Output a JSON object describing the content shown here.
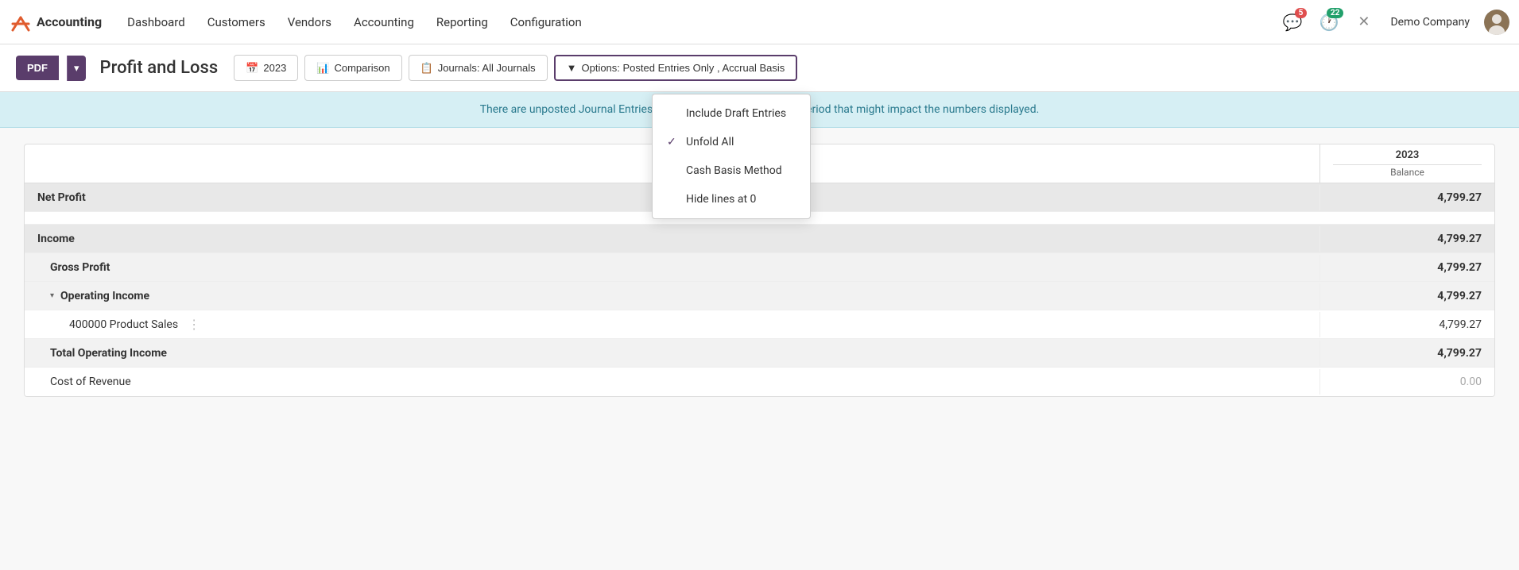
{
  "app": {
    "logo_text": "Accounting",
    "logo_icon": "✖"
  },
  "nav": {
    "items": [
      {
        "label": "Dashboard",
        "id": "dashboard"
      },
      {
        "label": "Customers",
        "id": "customers"
      },
      {
        "label": "Vendors",
        "id": "vendors"
      },
      {
        "label": "Accounting",
        "id": "accounting"
      },
      {
        "label": "Reporting",
        "id": "reporting"
      },
      {
        "label": "Configuration",
        "id": "configuration"
      }
    ],
    "badges": {
      "messages_count": "5",
      "activities_count": "22"
    },
    "company": "Demo Company"
  },
  "toolbar": {
    "pdf_label": "PDF",
    "page_title": "Profit and Loss",
    "year_btn": "2023",
    "comparison_btn": "Comparison",
    "journals_btn": "Journals: All Journals",
    "options_btn": "Options: Posted Entries Only , Accrual Basis"
  },
  "banner": {
    "text": "There are unposted Journal Entries prior to the end of this report period that might impact the numbers displayed."
  },
  "dropdown": {
    "items": [
      {
        "label": "Include Draft Entries",
        "checked": false,
        "id": "include-draft"
      },
      {
        "label": "Unfold All",
        "checked": true,
        "id": "unfold-all"
      },
      {
        "label": "Cash Basis Method",
        "checked": false,
        "id": "cash-basis"
      },
      {
        "label": "Hide lines at 0",
        "checked": false,
        "id": "hide-zero"
      }
    ]
  },
  "report": {
    "year_col": "2023",
    "balance_col": "Balance",
    "rows": [
      {
        "label": "Net Profit",
        "value": "4,799.27",
        "type": "section-header",
        "indent": 0
      },
      {
        "label": "",
        "value": "",
        "type": "spacer",
        "indent": 0
      },
      {
        "label": "Income",
        "value": "4,799.27",
        "type": "section-header",
        "indent": 0
      },
      {
        "label": "Gross Profit",
        "value": "4,799.27",
        "type": "sub-section",
        "indent": 1
      },
      {
        "label": "Operating Income",
        "value": "4,799.27",
        "type": "sub-section",
        "indent": 1,
        "expandable": true
      },
      {
        "label": "400000 Product Sales",
        "value": "4,799.27",
        "type": "data-row",
        "indent": 2,
        "dotmenu": true
      },
      {
        "label": "Total Operating Income",
        "value": "4,799.27",
        "type": "sub-section",
        "indent": 1
      },
      {
        "label": "Cost of Revenue",
        "value": "0.00",
        "type": "data-row",
        "indent": 1,
        "muted": true
      }
    ]
  }
}
